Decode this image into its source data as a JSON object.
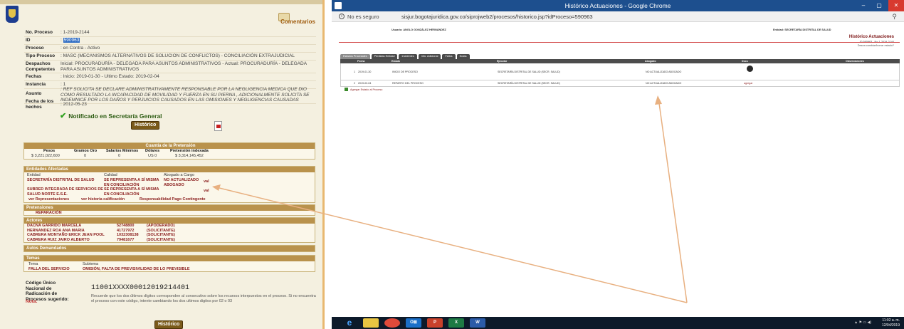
{
  "left": {
    "comentarios": "Comentarios",
    "fields": [
      {
        "label": "No. Proceso",
        "value": ": 1-2019-2144"
      },
      {
        "label": "ID",
        "value": "590963"
      },
      {
        "label": "Proceso",
        "value": ": en Contra - Activo"
      },
      {
        "label": "Tipo Proceso",
        "value": ": MASC (MECANISMOS ALTERNATIVOS DE SOLUCION DE CONFLICTOS) - CONCILIACIÓN EXTRAJUDICIAL"
      },
      {
        "label": "Despachos Competentes",
        "value": "Inicial: PROCURADURÍA - DELEGADA PARA ASUNTOS ADMINISTRATIVOS - Actual: PROCURADURÍA - DELEGADA PARA ASUNTOS ADMINISTRATIVOS"
      },
      {
        "label": "Fechas",
        "value": ": Inicio: 2019-01-30 - Ultimo Estado: 2019-02-04"
      },
      {
        "label": "Instancia",
        "value": ": 1"
      },
      {
        "label": "Asunto",
        "value": ": REF SOLICITA SE DECLARE ADMINISTRATIVAMENTE RESPONSABLE POR LA NEGLIGENCIA MEDICA QUE DIO COMO RESULTADO LA INCAPACIDAD DE MOVILIDAD Y FUERZA EN SU PIERNA , ADICIONALMENTE SOLICITA SE INDEMNICE POR LOS DAÑOS Y PERJUICIOS CAUSADOS EN LAS OMISIONES Y NEGLIGENCIAS CAUSADAS"
      },
      {
        "label": "Fecha de los hechos",
        "value": ": 2012-05-23"
      }
    ],
    "notificado": "Notificado en Secretaría General",
    "historico": "Histórico",
    "cuantia": {
      "title": "Cuantía de la Pretensión",
      "headers": [
        "Pesos",
        "Gramos Oro",
        "Salarios Mínimos",
        "Dólares",
        "Pretensión indexada"
      ],
      "values": [
        "$ 3,221,022,600",
        "0",
        "0",
        "US 0",
        "$ 3,314,145,452"
      ]
    },
    "entidades": {
      "title": "Entidades Afectadas",
      "headers": [
        "Entidad",
        "Calidad",
        "Abogado a Cargo"
      ],
      "rows": [
        {
          "entidad": "SECRETARÍA DISTRITAL DE SALUD",
          "calidad": "SE REPRESENTA A SÍ MISMA EN CONCILIACIÓN",
          "abogado": "NO ACTUALIZADO ABOGADO",
          "link": "val"
        },
        {
          "entidad": "SUBRED INTEGRADA DE SERVICIOS DE SALUD NORTE E.S.E.",
          "calidad": "SE REPRESENTA A SÍ MISMA EN CONCILIACIÓN",
          "abogado": "",
          "link": "val"
        }
      ],
      "links": [
        "ver Representaciones",
        "ver historia calificación",
        "Responsabilidad Pago Contingente"
      ]
    },
    "pretensiones": {
      "title": "Pretensiones",
      "item": "REPARACIÓN"
    },
    "actores": {
      "title": "Actores",
      "rows": [
        {
          "name": "DACNA GARRIDO MARCELA",
          "id": "52748800",
          "role": "(APODERADO)"
        },
        {
          "name": "HERNANDEZ ROA ANA MARIA",
          "id": "41727972",
          "role": "(SOLICITANTE)"
        },
        {
          "name": "CABRERA MONTAÑO ERICK JEAN POOL",
          "id": "1032308138",
          "role": "(SOLICITANTE)"
        },
        {
          "name": "CABRERA RUIZ JAIRO ALBERTO",
          "id": "79481677",
          "role": "(SOLICITANTE)"
        }
      ]
    },
    "autos": {
      "title": "Autos Demandados"
    },
    "temas": {
      "title": "Temas",
      "headers": [
        "Tema",
        "Subtema"
      ],
      "tema": "FALLA DEL SERVICIO",
      "subtema": "OMISIÓN, FALTA DE PREVISIVILIDAD DE LO PREVISIBLE"
    },
    "codigo_label": "Código Único Nacional de Radicación de Procesos sugerido:",
    "codigo": "11001XXXX00012019214401",
    "nota_label": "Nota:",
    "nota": "Recuerde que los dos últimos dígitos corresponden al consecutivo sobre los recursos interpuestos en el proceso. Si no encuentra el proceso con este código, intente cambiando los dos ultimos digitos por 02 o 03"
  },
  "window": {
    "title": "Histórico Actuaciones - Google Chrome",
    "minimize": "–",
    "maximize": "▢",
    "close": "✕",
    "security": "No es seguro",
    "url": "sisjur.bogotajuridica.gov.co/siprojweb2/procesos/historico.jsp?idProceso=590963",
    "usuario": "Usuario: ANGLO GONZÁLEZ HERNÁNDEZ",
    "entidad": "Entidad: SECRETARÍA DISTRITAL DE SALUD",
    "heading": "Histórico Actuaciones",
    "proc_no": "ID 590963 - No 1-2019-2144",
    "desea": "Desea cambiar/borrar estado?",
    "tabs": [
      "Estados Procesales",
      "Pérdidas Entidad",
      "Incidentes",
      "Info. Adicional",
      "Fallos",
      "Notas"
    ],
    "grid_headers": [
      "Fecha",
      "Estado",
      "Ejecutor",
      "Abogado",
      "Docs",
      "Observaciones"
    ],
    "rows": [
      {
        "num": "1",
        "fecha": "2019-01-30",
        "estado": "INICIO DE PROCESO",
        "ejecutor": "SECRETARÍA DISTRITAL DE SALUD (SECR. SALUD)",
        "abogado": "NO ACTUALIZADO ABOGADO",
        "doc": ""
      },
      {
        "num": "2",
        "fecha": "2019-02-04",
        "estado": "REPARTO DEL PROCESO",
        "ejecutor": "SECRETARÍA DISTRITAL DE SALUD (SECR. SALUD)",
        "abogado": "NO ACTUALIZADO ABOGADO",
        "doc": "agregar"
      }
    ],
    "add_link": "Agregar Estado al Proceso"
  },
  "taskbar": {
    "apps": [
      "e",
      "",
      "",
      "O⊠",
      "P",
      "X",
      "W"
    ],
    "time": "11:02 a. m.",
    "date": "12/04/2019"
  },
  "colors": {
    "accent": "#b9924c",
    "arrow": "#e8b080",
    "title": "#1d4f8e"
  }
}
